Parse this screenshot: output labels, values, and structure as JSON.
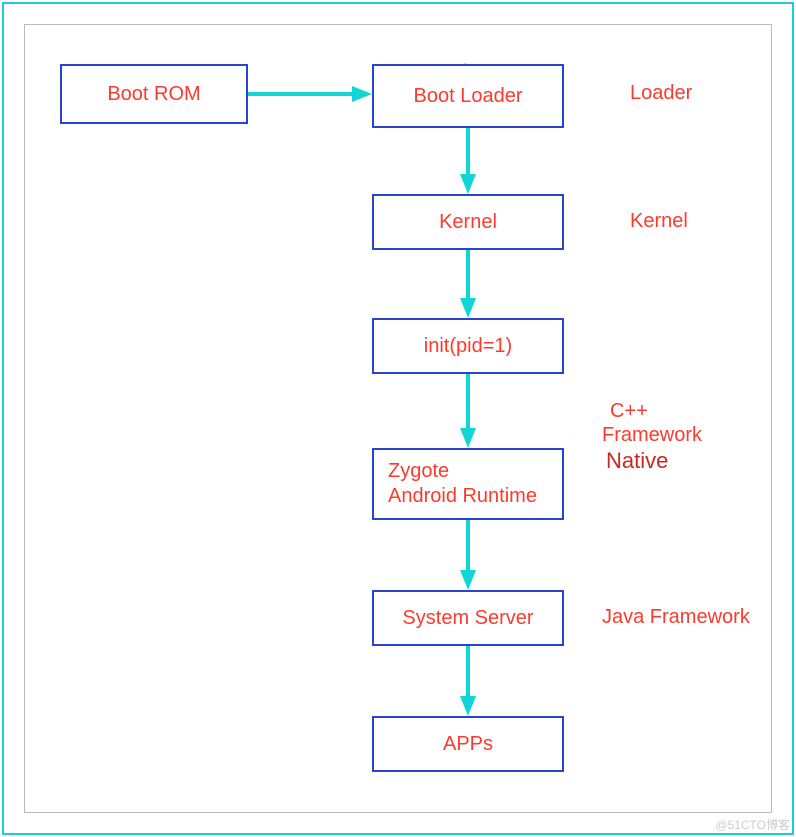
{
  "nodes": {
    "boot_rom": "Boot ROM",
    "boot_loader": "Boot Loader",
    "kernel": "Kernel",
    "init": "init(pid=1)",
    "zygote": "Zygote\nAndroid Runtime",
    "system_server": "System Server",
    "apps": "APPs"
  },
  "labels": {
    "loader": "Loader",
    "kernel": "Kernel",
    "cpp": "C++",
    "framework": "Framework",
    "native": "Native",
    "java_framework": "Java Framework"
  },
  "watermark": "@51CTO博客",
  "tick": "'"
}
